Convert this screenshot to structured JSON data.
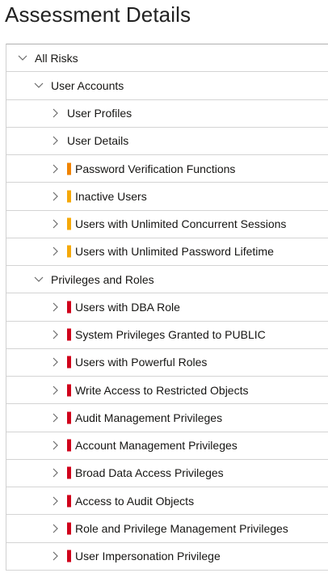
{
  "page": {
    "title": "Assessment Details"
  },
  "colors": {
    "high": "#d0021b",
    "medium": "#f08300",
    "low": "#f5a90a",
    "chevron": "#6b6b6b"
  },
  "tree": [
    {
      "label": "All Risks",
      "level": 0,
      "expanded": true,
      "icon": "chevron-down-icon"
    },
    {
      "label": "User Accounts",
      "level": 1,
      "expanded": true,
      "icon": "chevron-down-icon"
    },
    {
      "label": "User Profiles",
      "level": 2,
      "icon": "chevron-right-icon",
      "severity": null
    },
    {
      "label": "User Details",
      "level": 2,
      "icon": "chevron-right-icon",
      "severity": null
    },
    {
      "label": "Password Verification Functions",
      "level": 2,
      "icon": "chevron-right-icon",
      "severity": "medium"
    },
    {
      "label": "Inactive Users",
      "level": 2,
      "icon": "chevron-right-icon",
      "severity": "low"
    },
    {
      "label": "Users with Unlimited Concurrent Sessions",
      "level": 2,
      "icon": "chevron-right-icon",
      "severity": "low"
    },
    {
      "label": "Users with Unlimited Password Lifetime",
      "level": 2,
      "icon": "chevron-right-icon",
      "severity": "low"
    },
    {
      "label": "Privileges and Roles",
      "level": 1,
      "expanded": true,
      "icon": "chevron-down-icon"
    },
    {
      "label": "Users with DBA Role",
      "level": 2,
      "icon": "chevron-right-icon",
      "severity": "high"
    },
    {
      "label": "System Privileges Granted to PUBLIC",
      "level": 2,
      "icon": "chevron-right-icon",
      "severity": "high"
    },
    {
      "label": "Users with Powerful Roles",
      "level": 2,
      "icon": "chevron-right-icon",
      "severity": "high"
    },
    {
      "label": "Write Access to Restricted Objects",
      "level": 2,
      "icon": "chevron-right-icon",
      "severity": "high"
    },
    {
      "label": "Audit Management Privileges",
      "level": 2,
      "icon": "chevron-right-icon",
      "severity": "high"
    },
    {
      "label": "Account Management Privileges",
      "level": 2,
      "icon": "chevron-right-icon",
      "severity": "high"
    },
    {
      "label": "Broad Data Access Privileges",
      "level": 2,
      "icon": "chevron-right-icon",
      "severity": "high"
    },
    {
      "label": "Access to Audit Objects",
      "level": 2,
      "icon": "chevron-right-icon",
      "severity": "high"
    },
    {
      "label": "Role and Privilege Management Privileges",
      "level": 2,
      "icon": "chevron-right-icon",
      "severity": "high"
    },
    {
      "label": "User Impersonation Privilege",
      "level": 2,
      "icon": "chevron-right-icon",
      "severity": "high"
    }
  ]
}
